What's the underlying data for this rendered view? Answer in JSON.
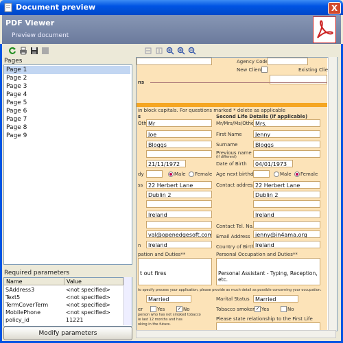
{
  "window": {
    "title": "Document preview",
    "close_label": "X"
  },
  "header": {
    "title": "PDF Viewer",
    "subtitle": "Preview document"
  },
  "left_panel": {
    "pages_label": "Pages",
    "pages": [
      "Page 1",
      "Page 2",
      "Page 3",
      "Page 4",
      "Page 5",
      "Page 6",
      "Page 7",
      "Page 8",
      "Page 9"
    ],
    "selected_page": "Page 1",
    "required_label": "Required parameters",
    "table": {
      "columns": [
        "Name",
        "Value"
      ],
      "rows": [
        {
          "name": "SAddress3",
          "value": "<not specified>"
        },
        {
          "name": "Text5",
          "value": "<not specified>"
        },
        {
          "name": "TermCoverTerm",
          "value": "<not specified>"
        },
        {
          "name": "MobilePhone",
          "value": "<not specified>"
        },
        {
          "name": "policy_id",
          "value": "11221"
        }
      ]
    },
    "modify_button": "Modify parameters"
  },
  "document": {
    "agency_code_label": "Agency Code",
    "new_client_label": "New Client",
    "existing_client_label": "Existing Client",
    "percent_mark": "%",
    "ns_label": "ns",
    "instructions": "in block capitals. For questions marked * delete as applicable",
    "first_col_head": "s",
    "second_life_head": "Second Life Details (if applicable)",
    "labels": {
      "title": "Mr/Mrs/Ms/Other*",
      "first_name": "First Name",
      "surname": "Surname",
      "previous_name": "Previous name",
      "previous_name_note": "(if different)",
      "dob": "Date of Birth",
      "age_next_birthday": "Age next birthday",
      "contact_address": "Contact address",
      "contact_tel": "Contact Tel. No.",
      "email": "Email Address",
      "country_of_birth": "Country of Birth",
      "occupation": "Personal Occupation and Duties**",
      "occupation_left": "pation and Duties**",
      "marital_status": "Marital Status",
      "tobacco_smoker": "Tobacco smoker*",
      "relationship": "Please state relationship to the First Life",
      "male": "Male",
      "female": "Female",
      "yes": "Yes",
      "no": "No",
      "left_title": "Other*",
      "left_dy": "dy",
      "left_ss": "ss",
      "left_n": "n",
      "left_er": "er",
      "speculative_note": "to specify process your application, please provide as much detail as possible concerning your occupation.",
      "smoker_note_1": "person who has not smoked tobacco",
      "smoker_note_2": "ie last 12 months and has",
      "smoker_note_3": "oking in the future."
    },
    "first_life": {
      "title": "Mr",
      "first_name": "Joe",
      "surname": "Bloggs",
      "dob": "21/11/1972",
      "address1": "22 Herbert Lane",
      "address2": "Dublin 2",
      "country": "Ireland",
      "email": "val@openedgesoft.com",
      "country_of_birth": "Ireland",
      "occupation": "t out fires",
      "marital_status": "Married"
    },
    "second_life": {
      "title": "Mrs.",
      "first_name": "Jenny",
      "surname": "Bloggs",
      "dob": "04/01/1973",
      "address1": "22 Herbert Lane",
      "address2": "Dublin 2",
      "country": "Ireland",
      "email": "jenny@in4ama.org",
      "country_of_birth": "Ireland",
      "occupation": "Personal Assistant - Typing, Reception, etc.",
      "marital_status": "Married"
    }
  },
  "icons": {
    "refresh": "refresh-icon",
    "print": "print-icon",
    "save": "save-icon",
    "stop": "stop-icon",
    "fit_width": "fit-width-icon",
    "fit_page": "fit-page-icon",
    "zoom_in": "zoom-in-icon",
    "zoom_out": "zoom-out-icon"
  },
  "colors": {
    "accent": "#0054e3",
    "doc_bg": "#fce3b8",
    "orange": "#f5a623",
    "selected_row": "#c2d6f2"
  }
}
